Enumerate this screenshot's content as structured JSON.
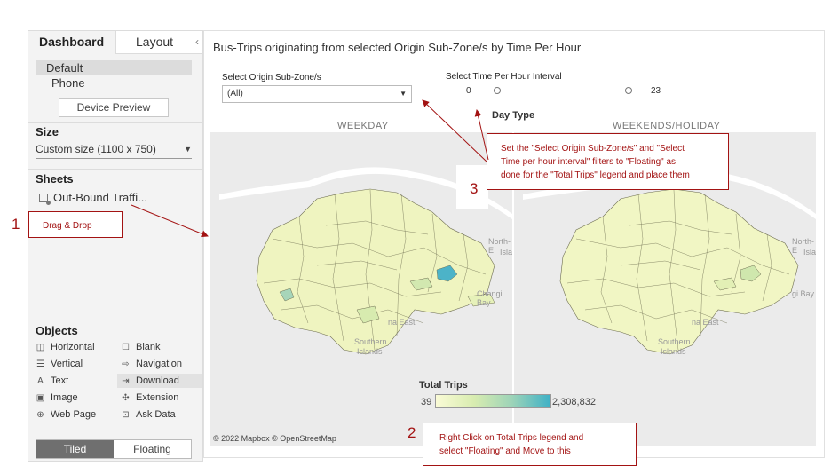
{
  "left_panel": {
    "tabs": {
      "dashboard": "Dashboard",
      "layout": "Layout",
      "collapse_glyph": "‹"
    },
    "device": {
      "default": "Default",
      "phone": "Phone",
      "preview_button": "Device Preview"
    },
    "size": {
      "title": "Size",
      "value": "Custom size (1100 x 750)"
    },
    "sheets": {
      "title": "Sheets",
      "item": "Out-Bound Traffi..."
    },
    "objects": {
      "title": "Objects",
      "items": [
        {
          "label": "Horizontal",
          "icon": "horizontal-icon"
        },
        {
          "label": "Blank",
          "icon": "blank-icon"
        },
        {
          "label": "Vertical",
          "icon": "vertical-icon"
        },
        {
          "label": "Navigation",
          "icon": "navigation-icon"
        },
        {
          "label": "Text",
          "icon": "text-icon"
        },
        {
          "label": "Download",
          "icon": "download-icon"
        },
        {
          "label": "Image",
          "icon": "image-icon"
        },
        {
          "label": "Extension",
          "icon": "extension-icon"
        },
        {
          "label": "Web Page",
          "icon": "globe-icon"
        },
        {
          "label": "Ask Data",
          "icon": "ask-data-icon"
        }
      ]
    },
    "layout_mode": {
      "tiled": "Tiled",
      "floating": "Floating",
      "selected": "Tiled"
    }
  },
  "dashboard": {
    "title": "Bus-Trips originating from selected Origin Sub-Zone/s by Time Per Hour",
    "origin_filter": {
      "label": "Select Origin Sub-Zone/s",
      "value": "(All)"
    },
    "time_filter": {
      "label": "Select Time Per Hour Interval",
      "min": "0",
      "max": "23",
      "range": [
        0,
        23
      ]
    },
    "day_type_label": "Day Type",
    "panels": [
      {
        "header": "WEEKDAY",
        "labels": {
          "north_east": "North-E",
          "isl": "Isla",
          "changi": "Changi Bay",
          "marina": "na East",
          "southern": "Southern",
          "islands": "Islands"
        }
      },
      {
        "header": "WEEKENDS/HOLIDAY",
        "labels": {
          "north_east": "North-E",
          "isl": "Isla",
          "changi": "gi Bay",
          "marina": "na East",
          "southern": "Southern",
          "islands": "Islands"
        }
      }
    ],
    "legend": {
      "title": "Total Trips",
      "min": "39",
      "max": "2,308,832",
      "colors": [
        "#fafbd6",
        "#d8ecb0",
        "#9cd3b8",
        "#3fb1c6"
      ]
    },
    "copyright": "© 2022 Mapbox © OpenStreetMap"
  },
  "annotations": {
    "step1": {
      "number": "1",
      "text": "Drag & Drop"
    },
    "step2": {
      "number": "2",
      "line1": "Right Click on Total Trips legend and",
      "line2": "select \"Floating\" and Move to this"
    },
    "step3": {
      "number": "3",
      "line1": "Set the \"Select Origin Sub-Zone/s\" and \"Select",
      "line2": "Time per hour interval\" filters to \"Floating\" as",
      "line3": "done for the \"Total Trips\" legend and place them"
    },
    "color": "#a31313"
  }
}
